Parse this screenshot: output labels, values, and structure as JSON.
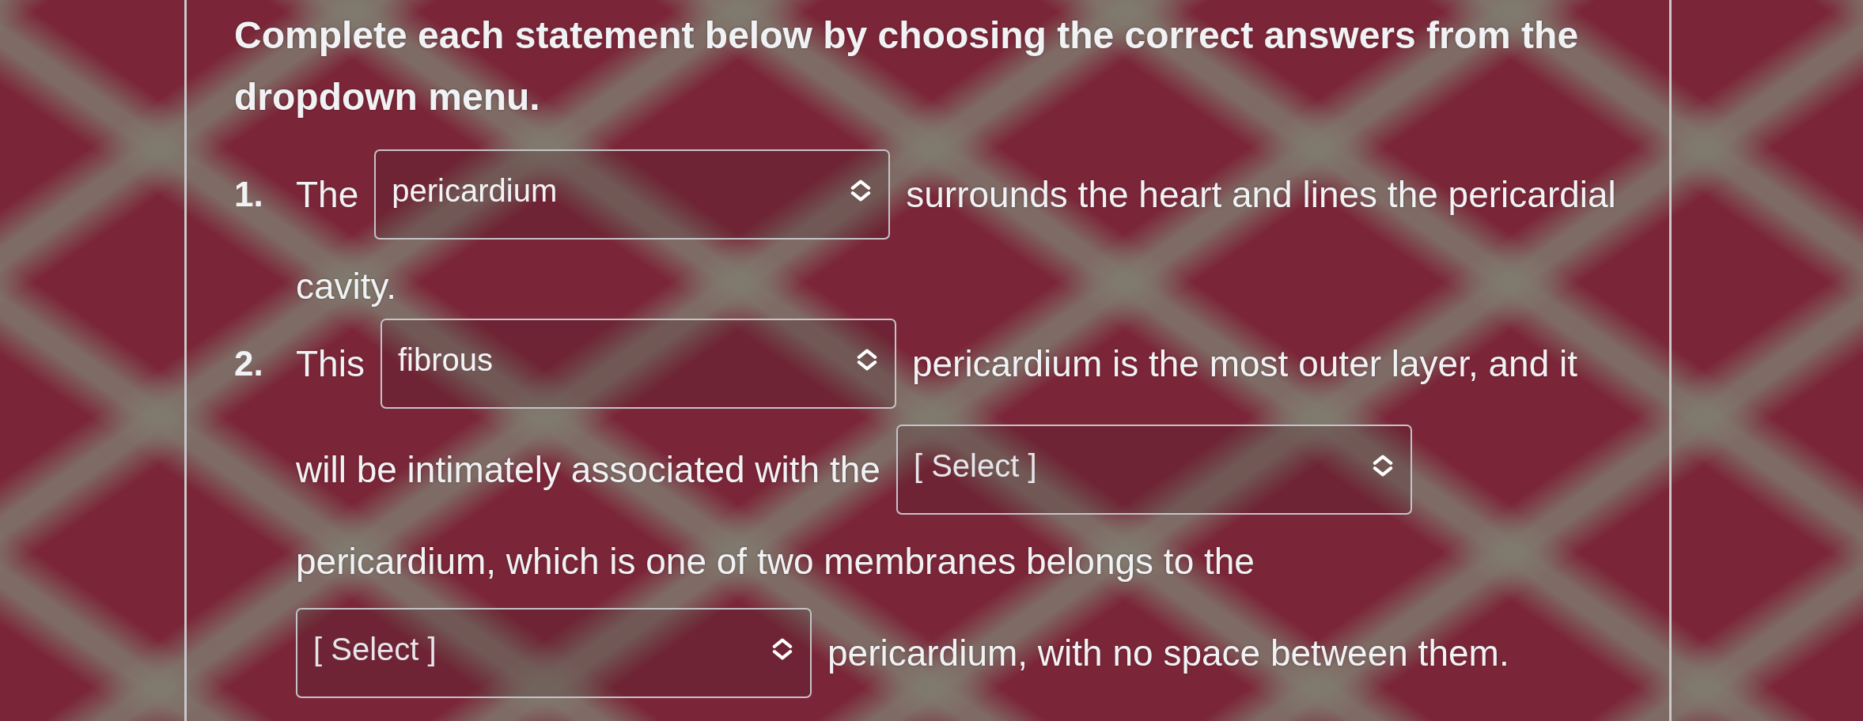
{
  "instructions": "Complete each statement below by choosing the correct answers from the dropdown menu.",
  "questions": [
    {
      "number": "1.",
      "lines": [
        [
          {
            "kind": "text",
            "text": "The"
          },
          {
            "kind": "dropdown",
            "value": "pericardium"
          },
          {
            "kind": "text",
            "text": "surrounds the heart and lines the pericardial"
          }
        ],
        [
          {
            "kind": "text",
            "text": "cavity."
          }
        ]
      ]
    },
    {
      "number": "2.",
      "lines": [
        [
          {
            "kind": "text",
            "text": "This"
          },
          {
            "kind": "dropdown",
            "value": "fibrous"
          },
          {
            "kind": "text",
            "text": "pericardium is the most outer layer, and it"
          }
        ],
        [
          {
            "kind": "text",
            "text": "will be intimately associated with the"
          },
          {
            "kind": "dropdown",
            "placeholder": "[ Select ]"
          }
        ],
        [
          {
            "kind": "text",
            "text": "pericardium, which is one of two membranes belongs to the"
          }
        ],
        [
          {
            "kind": "dropdown",
            "placeholder": "[ Select ]"
          },
          {
            "kind": "text",
            "text": "pericardium, with no space between them."
          }
        ]
      ]
    }
  ]
}
